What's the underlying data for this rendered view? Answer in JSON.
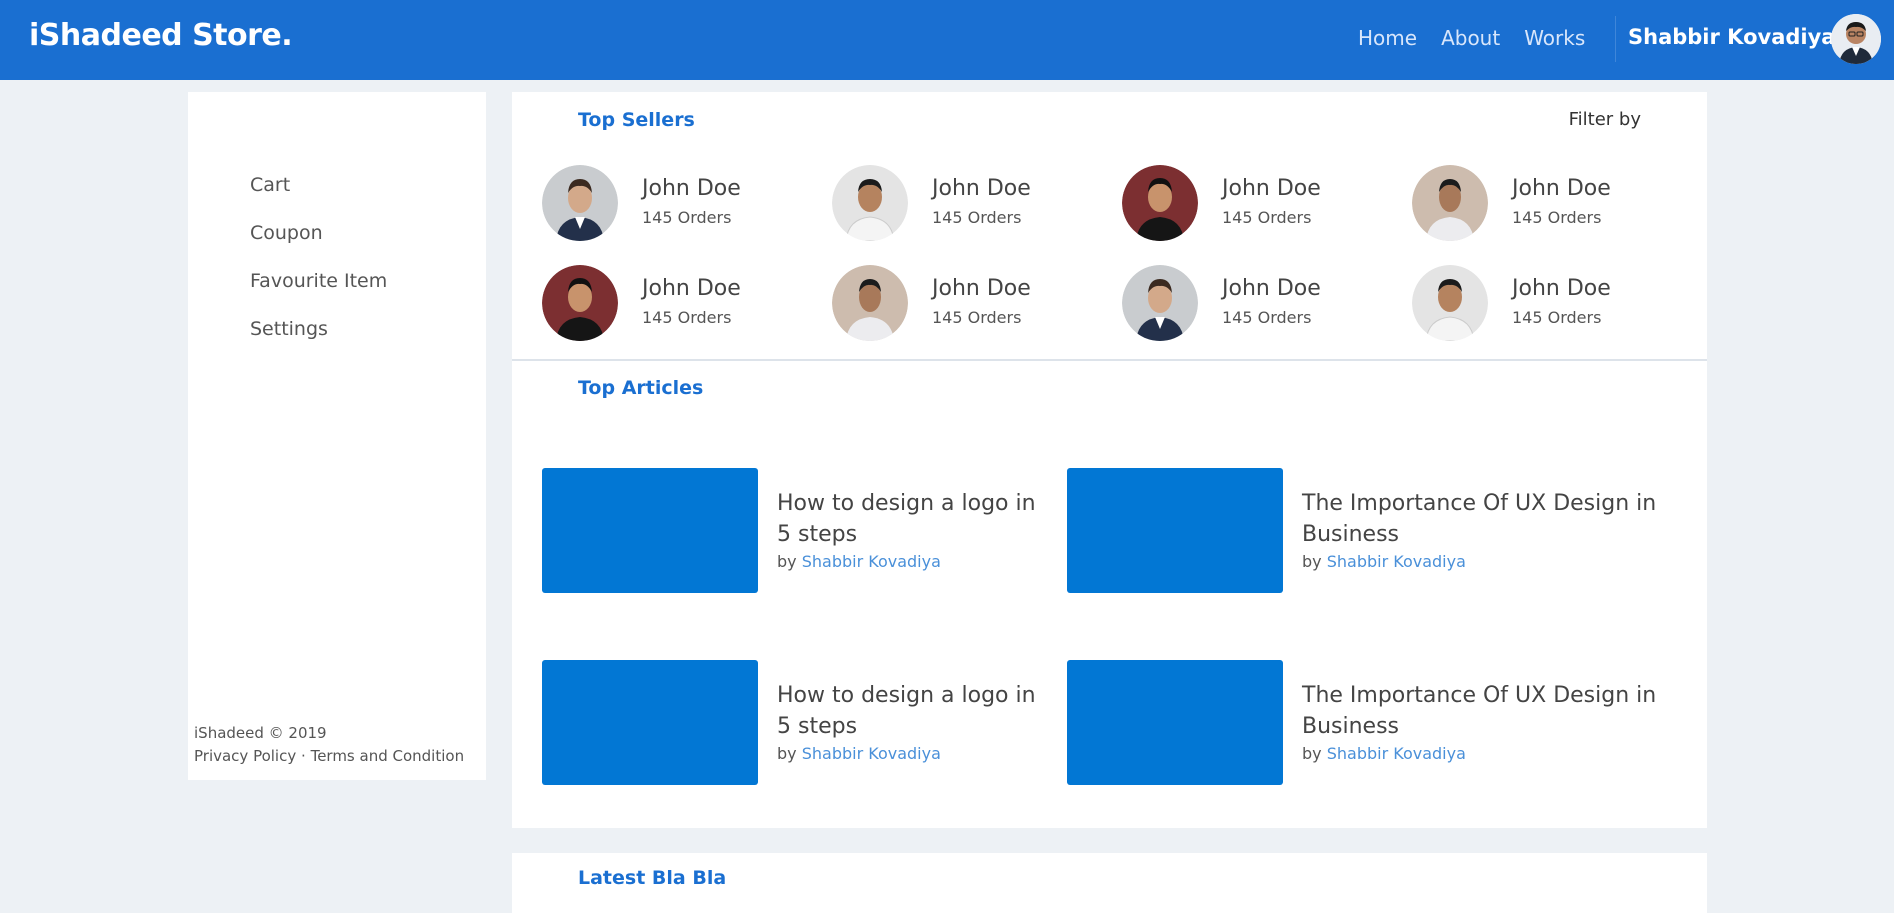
{
  "header": {
    "brand": "iShadeed Store.",
    "nav": [
      "Home",
      "About",
      "Works"
    ],
    "username": "Shabbir Kovadiya"
  },
  "sidebar": {
    "items": [
      "Cart",
      "Coupon",
      "Favourite Item",
      "Settings"
    ],
    "footer": {
      "copyright": "iShadeed © 2019",
      "privacy": "Privacy Policy",
      "separator": "·",
      "terms": "Terms and Condition"
    }
  },
  "sellers": {
    "title": "Top Sellers",
    "filter": "Filter by",
    "items": [
      {
        "name": "John Doe",
        "orders": "145 Orders",
        "tone": "bg-grey"
      },
      {
        "name": "John Doe",
        "orders": "145 Orders",
        "tone": "bg-light"
      },
      {
        "name": "John Doe",
        "orders": "145 Orders",
        "tone": "bg-red"
      },
      {
        "name": "John Doe",
        "orders": "145 Orders",
        "tone": "bg-beige"
      },
      {
        "name": "John Doe",
        "orders": "145 Orders",
        "tone": "bg-red"
      },
      {
        "name": "John Doe",
        "orders": "145 Orders",
        "tone": "bg-beige"
      },
      {
        "name": "John Doe",
        "orders": "145 Orders",
        "tone": "bg-grey"
      },
      {
        "name": "John Doe",
        "orders": "145 Orders",
        "tone": "bg-light"
      }
    ]
  },
  "articles": {
    "title": "Top Articles",
    "items": [
      {
        "title": "How to design a logo in 5 steps",
        "by": "by",
        "author": "Shabbir Kovadiya"
      },
      {
        "title": "The Importance Of UX Design in Business",
        "by": "by",
        "author": "Shabbir Kovadiya"
      },
      {
        "title": "How to design a logo in 5 steps",
        "by": "by",
        "author": "Shabbir Kovadiya"
      },
      {
        "title": "The Importance Of UX Design in Business",
        "by": "by",
        "author": "Shabbir Kovadiya"
      }
    ]
  },
  "latest": {
    "title": "Latest Bla Bla"
  },
  "colors": {
    "header": "#1a6fd1",
    "accent": "#1a6fd1",
    "thumb": "#0277d4",
    "link": "#4a90d9",
    "page_bg": "#edf1f5"
  }
}
